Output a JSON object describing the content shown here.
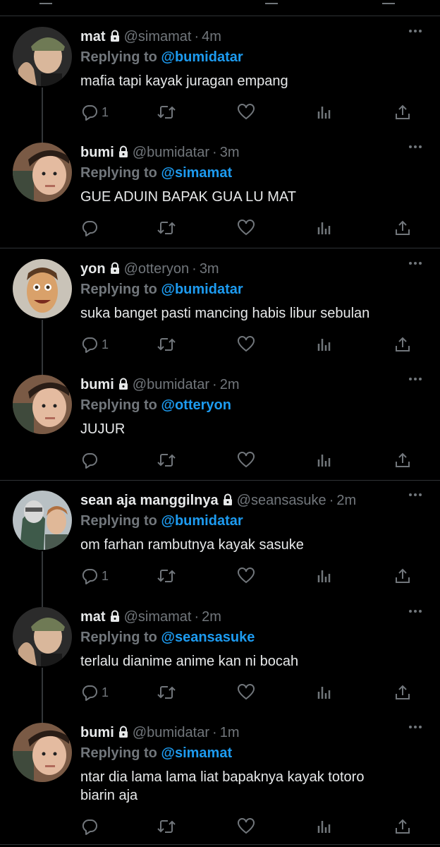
{
  "replying_prefix": "Replying to",
  "tweets": [
    {
      "name": "mat",
      "handle": "@simamat",
      "time": "4m",
      "reply_to": "@bumidatar",
      "text": "mafia tapi kayak juragan empang",
      "reply_count": "1"
    },
    {
      "name": "bumi",
      "handle": "@bumidatar",
      "time": "3m",
      "reply_to": "@simamat",
      "text": "GUE ADUIN BAPAK GUA LU MAT",
      "reply_count": ""
    },
    {
      "name": "yon",
      "handle": "@otteryon",
      "time": "3m",
      "reply_to": "@bumidatar",
      "text": "suka banget pasti mancing habis libur sebulan",
      "reply_count": "1"
    },
    {
      "name": "bumi",
      "handle": "@bumidatar",
      "time": "2m",
      "reply_to": "@otteryon",
      "text": "JUJUR",
      "reply_count": ""
    },
    {
      "name": "sean aja manggilnya",
      "handle": "@seansasuke",
      "time": "2m",
      "reply_to": "@bumidatar",
      "text": "om farhan rambutnya kayak sasuke",
      "reply_count": "1"
    },
    {
      "name": "mat",
      "handle": "@simamat",
      "time": "2m",
      "reply_to": "@seansasuke",
      "text": "terlalu dianime anime kan ni bocah",
      "reply_count": "1"
    },
    {
      "name": "bumi",
      "handle": "@bumidatar",
      "time": "1m",
      "reply_to": "@simamat",
      "text": "ntar dia lama lama liat bapaknya kayak totoro biarin aja",
      "reply_count": ""
    }
  ],
  "colors": {
    "background": "#000000",
    "text": "#e7e9ea",
    "muted": "#71767b",
    "link": "#1d9bf0",
    "divider": "#2f3336"
  },
  "icons": [
    "lock-icon",
    "more-icon",
    "reply-icon",
    "retweet-icon",
    "like-icon",
    "views-icon",
    "share-icon"
  ]
}
